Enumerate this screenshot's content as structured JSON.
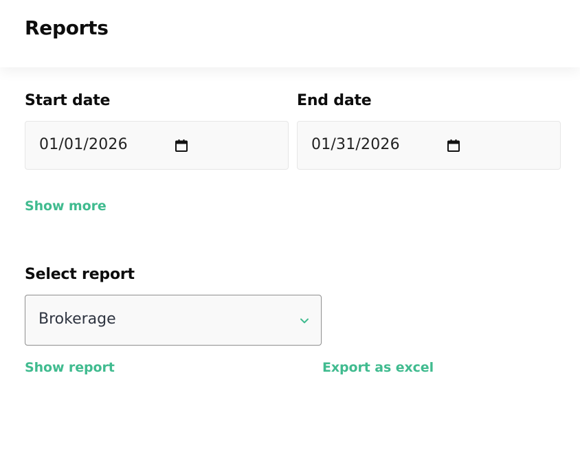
{
  "header": {
    "title": "Reports"
  },
  "filters": {
    "start_date": {
      "label": "Start date",
      "value": "01/01/2026",
      "icon": "calendar-icon"
    },
    "end_date": {
      "label": "End date",
      "value": "01/31/2026",
      "icon": "calendar-icon"
    },
    "show_more_label": "Show more"
  },
  "report": {
    "label": "Select report",
    "selected": "Brokerage",
    "icon": "chevron-down-icon"
  },
  "actions": {
    "show_report_label": "Show report",
    "export_label": "Export as excel"
  },
  "colors": {
    "accent": "#40bb8f",
    "input_background": "#f9f9f9",
    "select_border": "#8e8e8e"
  }
}
